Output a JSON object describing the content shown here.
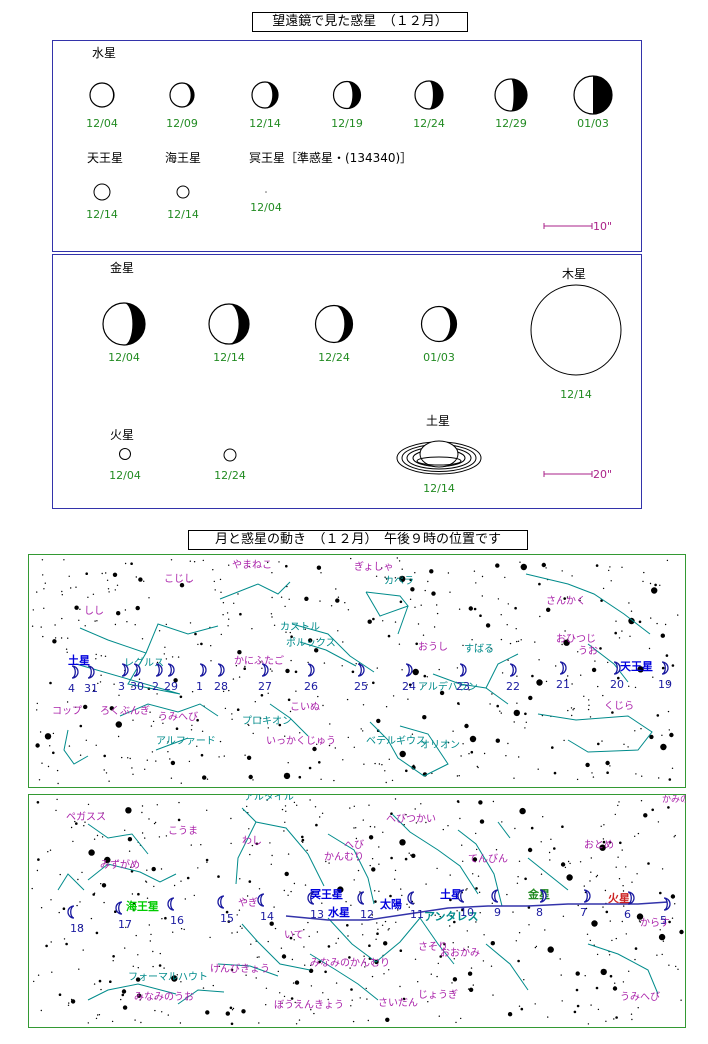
{
  "telescope": {
    "title": "望遠鏡で見た惑星　（１２月）",
    "panel1": {
      "mercury_label": "水星",
      "mercury_dates": [
        "12/04",
        "12/09",
        "12/14",
        "12/19",
        "12/24",
        "12/29",
        "01/03"
      ],
      "uranus_label": "天王星",
      "uranus_date": "12/14",
      "neptune_label": "海王星",
      "neptune_date": "12/14",
      "pluto_label": "冥王星［準惑星・(134340)］",
      "pluto_date": "12/04",
      "scale_label": "10\""
    },
    "panel2": {
      "venus_label": "金星",
      "venus_dates": [
        "12/04",
        "12/14",
        "12/24",
        "01/03"
      ],
      "jupiter_label": "木星",
      "jupiter_date": "12/14",
      "mars_label": "火星",
      "mars_dates": [
        "12/04",
        "12/24"
      ],
      "saturn_label": "土星",
      "saturn_date": "12/14",
      "scale_label": "20\""
    }
  },
  "movement": {
    "title": "月と惑星の動き　（１２月）　午後９時の位置です",
    "map1": {
      "constellations": [
        "こじし",
        "やまねこ",
        "ぎょしゃ",
        "カペラ",
        "さんかく",
        "しし",
        "カストル",
        "ポルックス",
        "おうし",
        "すばる",
        "おひつじ",
        "うお",
        "レグルス",
        "かに",
        "ふたご",
        "アルデバラン",
        "コップ",
        "ろくぶんぎ",
        "うみへび",
        "プロキオン",
        "こいぬ",
        "オリオン",
        "ベテルギウス",
        "いっかくじゅう",
        "アルファード",
        "くじら"
      ],
      "planet_labels": [
        "土星",
        "天王星"
      ],
      "moon_days": [
        "4",
        "31",
        "3",
        "30",
        "2",
        "29",
        "1",
        "28",
        "27",
        "26",
        "25",
        "24",
        "23",
        "22",
        "21",
        "20",
        "19"
      ]
    },
    "map2": {
      "constellations": [
        "ペガスス",
        "こうま",
        "わし",
        "アルタイル",
        "へび",
        "へびつかい",
        "かんむり",
        "みずがめ",
        "てんびん",
        "おとめ",
        "からす",
        "やぎ",
        "いて",
        "さそり",
        "おおかみ",
        "フォーマルハウト",
        "みなみのうお",
        "けんびきょう",
        "みなみのかんむり",
        "ぼうえんきょう",
        "さいだん",
        "じょうぎ",
        "うみへび"
      ],
      "planet_labels": [
        "海王星",
        "冥王星",
        "水星",
        "太陽",
        "金星",
        "火星",
        "土星",
        "アンタレス"
      ],
      "moon_days": [
        "18",
        "17",
        "16",
        "15",
        "14",
        "13",
        "12",
        "11",
        "10",
        "9",
        "8",
        "7",
        "6",
        "5"
      ]
    }
  },
  "colors": {
    "panel_border": "#3333aa",
    "map_border": "#339933",
    "date_green": "#228B22",
    "constellation_line": "#008b8b",
    "constellation_label": "#aa22aa",
    "planet_label": "#0000dd",
    "ecliptic": "#3333aa"
  }
}
